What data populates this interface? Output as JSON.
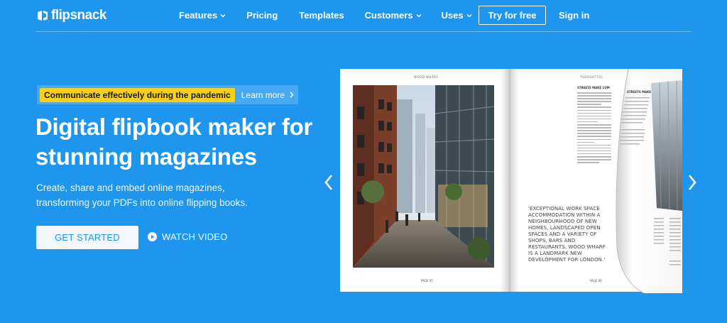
{
  "nav": {
    "brand": "flipsnack",
    "links": [
      {
        "label": "Features",
        "dropdown": true
      },
      {
        "label": "Pricing",
        "dropdown": false
      },
      {
        "label": "Templates",
        "dropdown": false
      },
      {
        "label": "Customers",
        "dropdown": true
      },
      {
        "label": "Uses",
        "dropdown": true
      }
    ],
    "try_label": "Try for free",
    "signin_label": "Sign in"
  },
  "hero": {
    "announcement": "Communicate effectively during the pandemic",
    "announcement_link": "Learn more",
    "headline": "Digital flipbook maker for stunning magazines",
    "subtext": "Create, share and embed online magazines, transforming your PDFs into online flipping books.",
    "primary_cta": "GET STARTED",
    "secondary_cta": "WATCH VIDEO"
  },
  "book": {
    "left_header": "WOOD WHARF",
    "right_header": "THOUGHTFUL",
    "right_col_head": "STREETS MAKE COM",
    "curl_col_head": "STREETS MAKE",
    "quote": "'EXCEPTIONAL WORK SPACE ACCOMMODATION WITHIN A NEIGHBOURHOOD OF NEW HOMES, LANDSCAPED OPEN SPACES AND A VARIETY OF SHOPS, BARS AND RESTAURANTS, WOOD WHARF IS A LANDMARK NEW DEVELOPMENT FOR LONDON.'",
    "left_page_no": "PAGE 05",
    "right_page_no": "PAGE 06"
  },
  "colors": {
    "background": "#1e96ee",
    "badge": "#f7cf1d",
    "button_bg": "#f3f6fa",
    "button_text": "#1e96ee"
  }
}
